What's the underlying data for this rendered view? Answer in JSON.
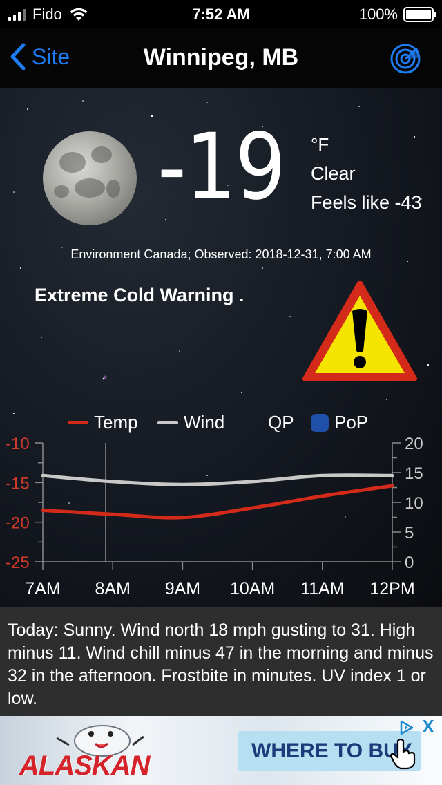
{
  "status_bar": {
    "carrier": "Fido",
    "time": "7:52 AM",
    "battery": "100%"
  },
  "nav": {
    "back_label": "Site",
    "title": "Winnipeg, MB",
    "radar_icon": "radar-icon"
  },
  "current": {
    "temperature": "-19",
    "unit": "°F",
    "condition": "Clear",
    "feels_like": "Feels like -43",
    "observed": "Environment Canada; Observed: 2018-12-31, 7:00 AM",
    "warning": "Extreme Cold Warning .",
    "moon_icon": "full-moon-icon",
    "warning_icon": "warning-triangle-icon"
  },
  "chart_legend": {
    "temp": "Temp",
    "wind": "Wind",
    "qp": "QP",
    "pop": "PoP"
  },
  "chart_data": {
    "type": "line",
    "categories": [
      "7AM",
      "8AM",
      "9AM",
      "10AM",
      "11AM",
      "12PM"
    ],
    "x": [
      7,
      8,
      9,
      10,
      11,
      12
    ],
    "left_axis": {
      "ticks": [
        -10,
        -15,
        -20,
        -25
      ],
      "ylim": [
        -25,
        -10
      ],
      "color": "#d03a2a"
    },
    "right_axis": {
      "ticks": [
        20,
        15,
        10,
        5,
        0
      ],
      "ylim": [
        0,
        20
      ],
      "color": "#cccccc"
    },
    "current_time_marker": 7.9,
    "series": [
      {
        "name": "Temp",
        "axis": "left",
        "color": "#d42a1a",
        "values": [
          -18.5,
          -19,
          -19.4,
          -18.2,
          -16.7,
          -15.4
        ]
      },
      {
        "name": "Wind",
        "axis": "right",
        "color": "#c8c8c8",
        "values": [
          14.5,
          13.5,
          13,
          13.5,
          14.5,
          14.5
        ]
      }
    ],
    "grid": false,
    "legend": "top"
  },
  "forecast": {
    "text": "Today:  Sunny. Wind north 18 mph gusting to 31. High minus 11. Wind chill minus 47 in the morning and minus 32 in the afternoon. Frostbite in minutes. UV index 1 or low."
  },
  "ad": {
    "brand": "ALASKAN",
    "cta": "WHERE TO BUY",
    "close": "X",
    "cursor_icon": "hand-pointer-icon",
    "choices_icon": "adchoices-icon"
  }
}
